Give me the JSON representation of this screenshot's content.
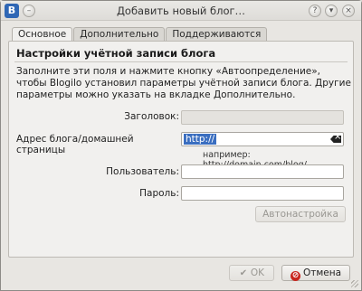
{
  "window": {
    "title": "Добавить новый блог…",
    "app_icon_letter": "B"
  },
  "tabs": [
    {
      "label": "Основное",
      "active": true
    },
    {
      "label": "Дополнительно",
      "active": false
    },
    {
      "label": "Поддерживаются",
      "active": false
    }
  ],
  "panel": {
    "heading": "Настройки учётной записи блога",
    "description": "Заполните эти поля и нажмите кнопку «Автоопределение», чтобы Blogilo установил параметры учётной записи блога. Другие параметры можно указать на вкладке Дополнительно."
  },
  "form": {
    "title_label": "Заголовок:",
    "title_value": "",
    "url_label": "Адрес блога/домашней страницы",
    "url_value": "http://",
    "url_hint": "например: http://domain.com/blog/",
    "user_label": "Пользователь:",
    "user_value": "",
    "password_label": "Пароль:",
    "password_value": "",
    "autoconfig_label": "Автонастройка"
  },
  "footer": {
    "ok_label": "OK",
    "cancel_label": "Отмена"
  }
}
